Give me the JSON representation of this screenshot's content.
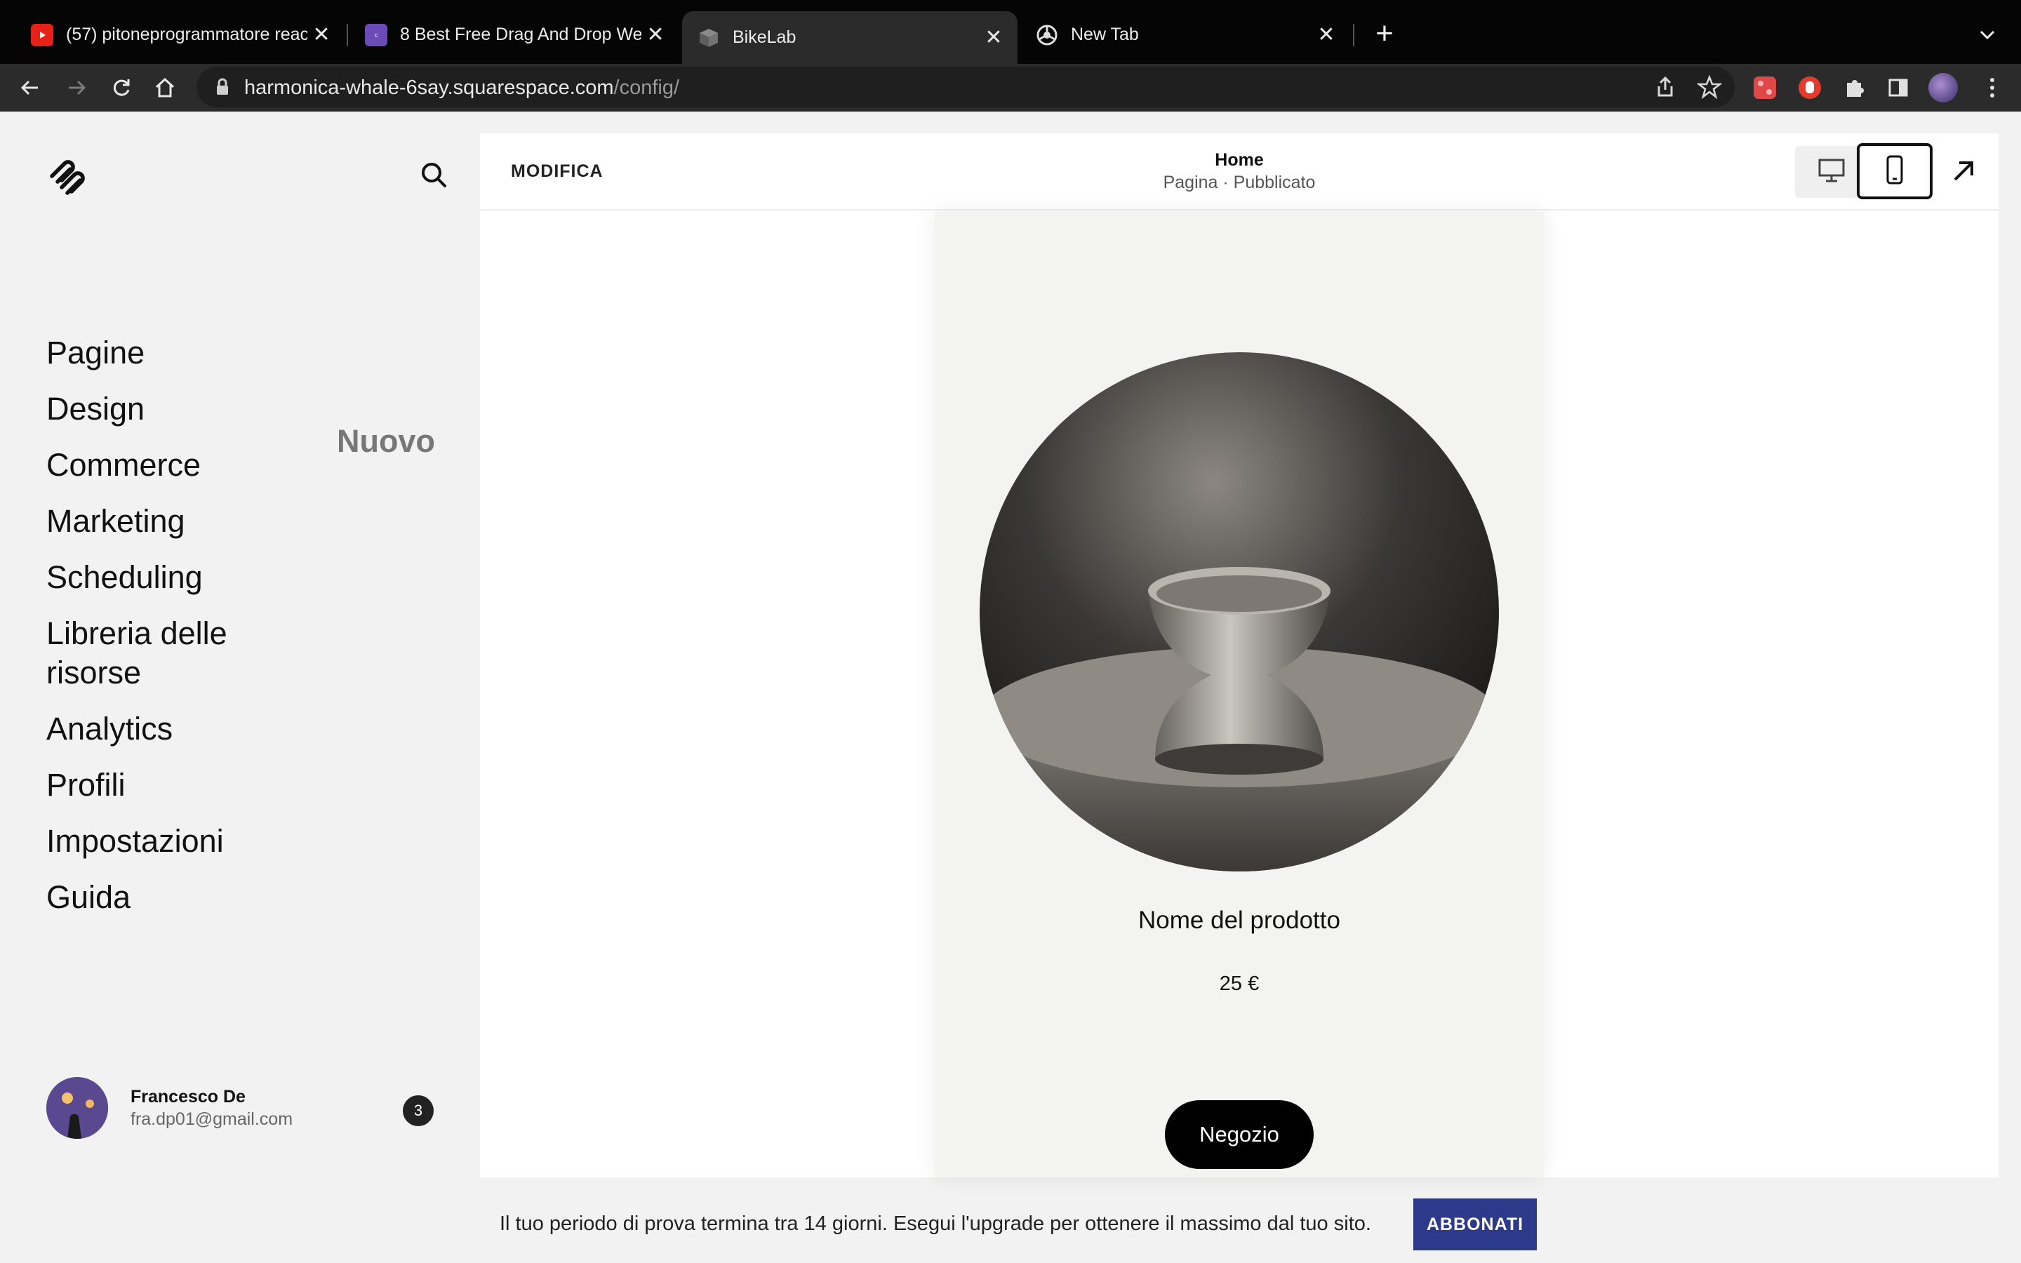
{
  "browser": {
    "tabs": [
      {
        "title": "(57) pitoneprogrammatore reac",
        "icon": "youtube-icon"
      },
      {
        "title": "8 Best Free Drag And Drop We",
        "icon": "colorlib-icon"
      },
      {
        "title": "BikeLab",
        "icon": "squarespace-cube-icon"
      },
      {
        "title": "New Tab",
        "icon": "chrome-icon"
      }
    ],
    "url_host": "harmonica-whale-6say.squarespace.com",
    "url_path": "/config/"
  },
  "sidebar": {
    "nav": [
      "Pagine",
      "Design",
      "Commerce",
      "Marketing",
      "Scheduling",
      "Libreria delle risorse",
      "Analytics",
      "Profili",
      "Impostazioni",
      "Guida"
    ],
    "new_badge": "Nuovo",
    "user_name": "Francesco De",
    "user_email": "fra.dp01@gmail.com",
    "notifications": "3"
  },
  "editor": {
    "edit_label": "MODIFICA",
    "page_title": "Home",
    "page_subtitle": "Pagina · Pubblicato"
  },
  "product": {
    "name": "Nome del prodotto",
    "price": "25 €",
    "shop_button": "Negozio"
  },
  "trial": {
    "message": "Il tuo periodo di prova termina tra 14 giorni. Esegui l'upgrade per ottenere il massimo dal tuo sito.",
    "button": "ABBONATI"
  },
  "colors": {
    "accent": "#2d3a8c",
    "chrome_dark": "#050505",
    "toolbar": "#2b2b2b"
  }
}
